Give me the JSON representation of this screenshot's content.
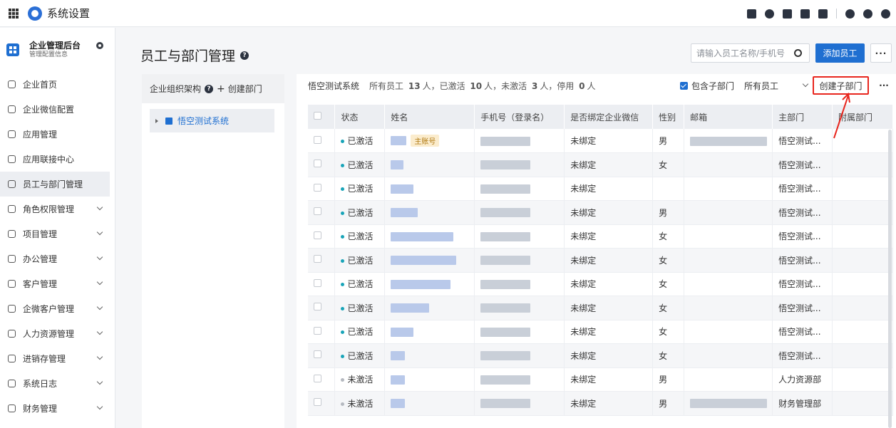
{
  "topbar": {
    "title": "系统设置"
  },
  "sidebar": {
    "title": "企业管理后台",
    "subtitle": "管理配置信息",
    "items": [
      {
        "label": "企业首页",
        "chevron": false
      },
      {
        "label": "企业微信配置",
        "chevron": false
      },
      {
        "label": "应用管理",
        "chevron": false
      },
      {
        "label": "应用联接中心",
        "chevron": false
      },
      {
        "label": "员工与部门管理",
        "chevron": false,
        "active": true
      },
      {
        "label": "角色权限管理",
        "chevron": true
      },
      {
        "label": "项目管理",
        "chevron": true
      },
      {
        "label": "办公管理",
        "chevron": true
      },
      {
        "label": "客户管理",
        "chevron": true
      },
      {
        "label": "企微客户管理",
        "chevron": true
      },
      {
        "label": "人力资源管理",
        "chevron": true
      },
      {
        "label": "进销存管理",
        "chevron": true
      },
      {
        "label": "系统日志",
        "chevron": true
      },
      {
        "label": "财务管理",
        "chevron": true
      }
    ]
  },
  "main": {
    "title": "员工与部门管理",
    "search_placeholder": "请输入员工名称/手机号",
    "add_employee": "添加员工"
  },
  "org": {
    "header": "企业组织架构",
    "create_dept": "创建部门",
    "root_node": "悟空测试系统"
  },
  "table": {
    "org_name": "悟空测试系统",
    "stats": {
      "prefix": "所有员工",
      "total": "13",
      "unit1": "人，已激活",
      "active": "10",
      "unit2": "人，未激活",
      "inactive": "3",
      "unit3": "人，停用",
      "disabled": "0",
      "unit4": "人"
    },
    "include_sub": "包含子部门",
    "filter": "所有员工",
    "create_sub": "创建子部门",
    "columns": [
      "状态",
      "姓名",
      "手机号（登录名）",
      "是否绑定企业微信",
      "性别",
      "邮箱",
      "主部门",
      "附属部门"
    ],
    "main_account_tag": "主账号",
    "rows": [
      {
        "status": "已激活",
        "active": true,
        "bound": "未绑定",
        "gender": "男",
        "dept": "悟空测试...",
        "email": true,
        "tag": true
      },
      {
        "status": "已激活",
        "active": true,
        "bound": "未绑定",
        "gender": "女",
        "dept": "悟空测试...",
        "email": false,
        "tag": false
      },
      {
        "status": "已激活",
        "active": true,
        "bound": "未绑定",
        "gender": "",
        "dept": "悟空测试...",
        "email": false,
        "tag": false
      },
      {
        "status": "已激活",
        "active": true,
        "bound": "未绑定",
        "gender": "男",
        "dept": "悟空测试...",
        "email": false,
        "tag": false
      },
      {
        "status": "已激活",
        "active": true,
        "bound": "未绑定",
        "gender": "女",
        "dept": "悟空测试...",
        "email": false,
        "tag": false
      },
      {
        "status": "已激活",
        "active": true,
        "bound": "未绑定",
        "gender": "女",
        "dept": "悟空测试...",
        "email": false,
        "tag": false
      },
      {
        "status": "已激活",
        "active": true,
        "bound": "未绑定",
        "gender": "女",
        "dept": "悟空测试...",
        "email": false,
        "tag": false
      },
      {
        "status": "已激活",
        "active": true,
        "bound": "未绑定",
        "gender": "女",
        "dept": "悟空测试...",
        "email": false,
        "tag": false
      },
      {
        "status": "已激活",
        "active": true,
        "bound": "未绑定",
        "gender": "女",
        "dept": "悟空测试...",
        "email": false,
        "tag": false
      },
      {
        "status": "已激活",
        "active": true,
        "bound": "未绑定",
        "gender": "女",
        "dept": "悟空测试...",
        "email": false,
        "tag": false
      },
      {
        "status": "未激活",
        "active": false,
        "bound": "未绑定",
        "gender": "男",
        "dept": "人力资源部",
        "email": false,
        "tag": false
      },
      {
        "status": "未激活",
        "active": false,
        "bound": "未绑定",
        "gender": "男",
        "dept": "财务管理部",
        "email": true,
        "tag": false
      }
    ]
  }
}
